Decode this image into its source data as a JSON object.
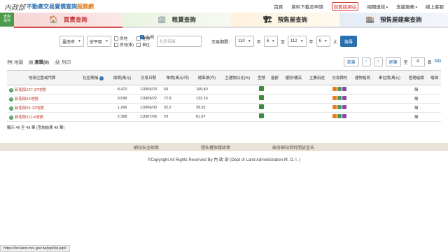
{
  "header": {
    "logo_mark": "內政部",
    "title": "不動產交易實價查詢",
    "title_sub": "服務網",
    "nav": [
      "首頁",
      "資料下載及申請",
      "回舊版網站",
      "相關連結",
      "支援服務",
      "線上客服"
    ]
  },
  "sidebar_tab": "查詢\n操作",
  "tabs": [
    "買賣查詢",
    "租賃查詢",
    "預售屋查詢",
    "預售屋建案查詢"
  ],
  "filter": {
    "city": "臺南市",
    "district": "安平區",
    "checks": [
      {
        "label": "房地",
        "on": false
      },
      {
        "label": "建物",
        "on": false
      },
      {
        "label": "土地",
        "on": true
      },
      {
        "label": "房地(車)",
        "on": false
      },
      {
        "label": "車位",
        "on": false
      }
    ],
    "community_placeholder": "社區名稱",
    "period_label": "交易期間：",
    "from_year": "110",
    "year_unit": "年",
    "from_month": "6",
    "to_label": "至",
    "to_year": "112",
    "to_month": "6",
    "month_unit": "止",
    "search_label": "搜尋"
  },
  "views": {
    "map": "地圖",
    "list": "清單(0)",
    "print": "列印"
  },
  "pager": {
    "first": "首筆",
    "prev": "‹",
    "next": "›",
    "last": "尾筆",
    "to_label": "至",
    "page": "4",
    "page_unit": "頁",
    "go": "GO"
  },
  "table": {
    "headers": [
      "地段位置或門牌",
      "社區簡稱",
      "總價(萬元)",
      "交易日期",
      "單價(萬元/坪)",
      "總面積(坪)",
      "主建物佔比(%)",
      "型態",
      "屋齡",
      "樓別/樓高",
      "主要用途",
      "交易標的",
      "建物格局",
      "車位價(萬元)",
      "管理組織",
      "電梯"
    ],
    "rows": [
      {
        "addr": "新南段127-37地號",
        "price": "8,470",
        "date": "110/09/23",
        "unit": "50",
        "area": "169.40",
        "mgmt": "無"
      },
      {
        "addr": "新南段53地號",
        "price": "9,698",
        "date": "110/09/22",
        "unit": "72.9",
        "area": "133.10",
        "mgmt": "無"
      },
      {
        "addr": "新南段93-12地號",
        "price": "1,266",
        "date": "110/08/30",
        "unit": "32.2",
        "area": "39.32",
        "mgmt": "無"
      },
      {
        "addr": "新南段111-4地號",
        "price": "2,368",
        "date": "110/07/26",
        "unit": "29",
        "area": "81.67",
        "mgmt": "無"
      }
    ]
  },
  "summary": "顯示 46 至 49 筆 (查詢結果 49 筆)",
  "footer": {
    "links": [
      "網站安全政策",
      "隱私權保護政策",
      "政府網站資料開放宣告"
    ],
    "copyright": "©Copyright All Rights Reserved By 內 政 部 (Dept of Land Administration M. O. I. )"
  },
  "status_url": "https://lvr.land.moi.gov.tw/jsp/list.jsp#"
}
